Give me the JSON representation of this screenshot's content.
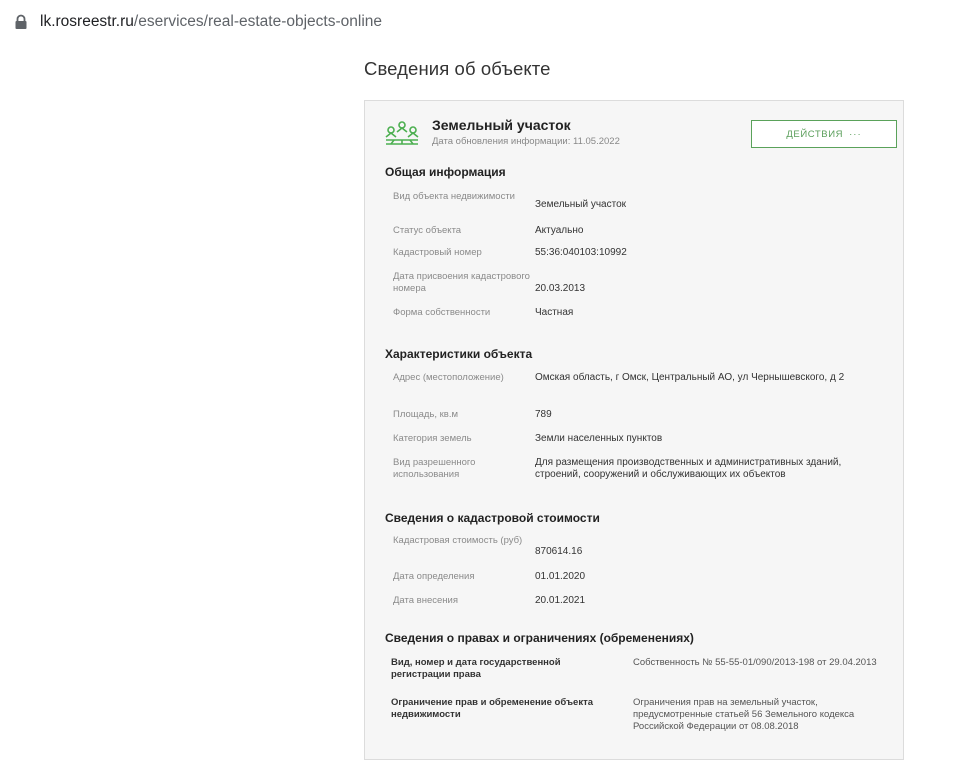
{
  "browser": {
    "url_domain": "lk.rosreestr.ru",
    "url_path": "/eservices/real-estate-objects-online"
  },
  "page": {
    "title": "Сведения об объекте"
  },
  "object": {
    "name": "Земельный участок",
    "updated": "Дата обновления информации: 11.05.2022",
    "actions_label": "ДЕЙСТВИЯ",
    "actions_dots": "···"
  },
  "general": {
    "title": "Общая информация",
    "rows": [
      {
        "label": "Вид объекта недвижимости",
        "value": "Земельный участок"
      },
      {
        "label": "Статус объекта",
        "value": "Актуально"
      },
      {
        "label": "Кадастровый номер",
        "value": "55:36:040103:10992"
      },
      {
        "label": "Дата присвоения кадастрового номера",
        "value": "20.03.2013"
      },
      {
        "label": "Форма собственности",
        "value": "Частная"
      }
    ]
  },
  "characteristics": {
    "title": "Характеристики объекта",
    "rows": [
      {
        "label": "Адрес (местоположение)",
        "value": "Омская область, г Омск, Центральный АО, ул Чернышевского, д 2"
      },
      {
        "label": "Площадь, кв.м",
        "value": "789"
      },
      {
        "label": "Категория земель",
        "value": "Земли населенных пунктов"
      },
      {
        "label": "Вид разрешенного использования",
        "value": "Для размещения производственных и административных зданий, строений, сооружений и обслуживающих их объектов"
      }
    ]
  },
  "cadastral": {
    "title": "Сведения о кадастровой стоимости",
    "rows": [
      {
        "label": "Кадастровая стоимость (руб)",
        "value": "870614.16"
      },
      {
        "label": "Дата определения",
        "value": "01.01.2020"
      },
      {
        "label": "Дата внесения",
        "value": "20.01.2021"
      }
    ]
  },
  "rights": {
    "title": "Сведения о правах и ограничениях (обременениях)",
    "rows": [
      {
        "label": "Вид, номер и дата государственной регистрации права",
        "value": "Собственность № 55-55-01/090/2013-198 от 29.04.2013"
      },
      {
        "label": "Ограничение прав и обременение объекта недвижимости",
        "value": "Ограничения прав на земельный участок, предусмотренные статьей 56 Земельного кодекса Российской Федерации от 08.08.2018"
      }
    ]
  }
}
